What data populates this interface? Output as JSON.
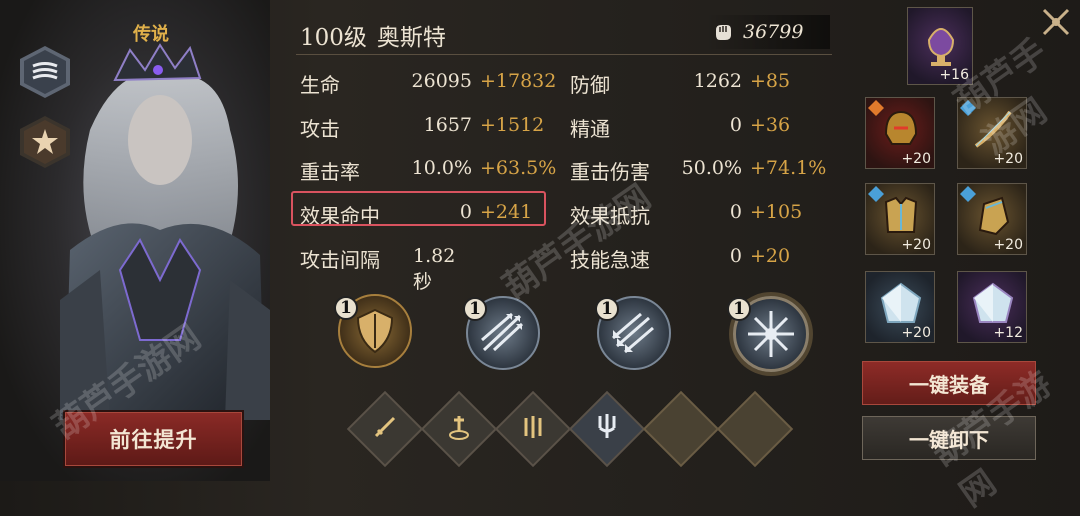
{
  "character": {
    "rarity": "传说",
    "level": "100级",
    "name": "奥斯特",
    "power": "36799",
    "upgrade_button": "前往提升"
  },
  "stats": [
    {
      "name": "生命",
      "base": "26095",
      "bonus": "+17832"
    },
    {
      "name": "防御",
      "base": "1262",
      "bonus": "+85"
    },
    {
      "name": "攻击",
      "base": "1657",
      "bonus": "+1512"
    },
    {
      "name": "精通",
      "base": "0",
      "bonus": "+36"
    },
    {
      "name": "重击率",
      "base": "10.0%",
      "bonus": "+63.5%"
    },
    {
      "name": "重击伤害",
      "base": "50.0%",
      "bonus": "+74.1%"
    },
    {
      "name": "效果命中",
      "base": "0",
      "bonus": "+241"
    },
    {
      "name": "效果抵抗",
      "base": "0",
      "bonus": "+105"
    },
    {
      "name": "攻击间隔",
      "base": "1.82秒",
      "bonus": ""
    },
    {
      "name": "技能急速",
      "base": "0",
      "bonus": "+20"
    }
  ],
  "skills": [
    {
      "level": "1",
      "icon": "shield-skill-icon"
    },
    {
      "level": "1",
      "icon": "spear-skill-icon"
    },
    {
      "level": "1",
      "icon": "arrows-skill-icon"
    },
    {
      "level": "1",
      "icon": "burst-skill-icon"
    }
  ],
  "runes": [
    "sword-rune-icon",
    "sword-stone-rune-icon",
    "triple-blade-rune-icon",
    "trident-rune-icon",
    "empty",
    "empty"
  ],
  "equipment": [
    {
      "slot": "artifact",
      "level": "+16",
      "icon": "lamp-icon"
    },
    {
      "slot": "helmet",
      "level": "+20",
      "icon": "helmet-icon"
    },
    {
      "slot": "weapon",
      "level": "+20",
      "icon": "bow-icon"
    },
    {
      "slot": "armor",
      "level": "+20",
      "icon": "armor-icon"
    },
    {
      "slot": "gloves",
      "level": "+20",
      "icon": "gloves-icon"
    },
    {
      "slot": "gem1",
      "level": "+20",
      "icon": "gem-icon"
    },
    {
      "slot": "gem2",
      "level": "+12",
      "icon": "gem-icon"
    }
  ],
  "buttons": {
    "equip_all": "一键装备",
    "unequip_all": "一键卸下"
  },
  "watermark": "葫芦手游网",
  "colors": {
    "bonus": "#d7a447",
    "highlight": "#d9535f",
    "rarity": "#e0b04a"
  }
}
